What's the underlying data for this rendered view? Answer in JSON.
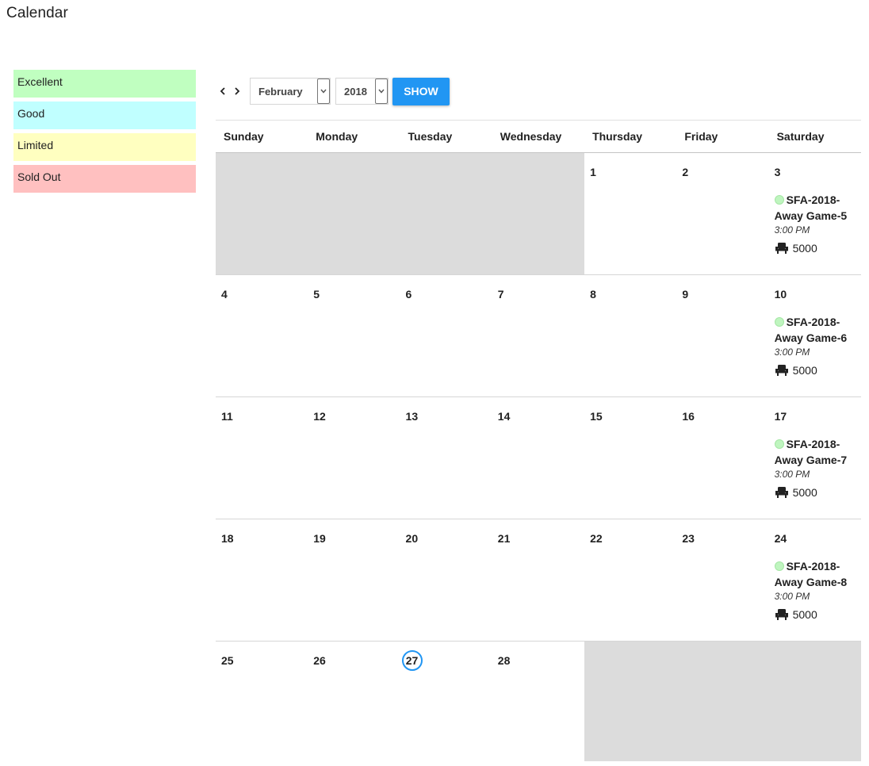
{
  "page": {
    "title": "Calendar"
  },
  "legend": [
    {
      "label": "Excellent",
      "color": "#c0ffc0"
    },
    {
      "label": "Good",
      "color": "#c0ffff"
    },
    {
      "label": "Limited",
      "color": "#ffffc0"
    },
    {
      "label": "Sold Out",
      "color": "#ffc0c0"
    }
  ],
  "toolbar": {
    "prev_icon": "chevron-left-icon",
    "next_icon": "chevron-right-icon",
    "month": "February",
    "year": "2018",
    "show_label": "SHOW"
  },
  "calendar": {
    "weekdays": [
      "Sunday",
      "Monday",
      "Tuesday",
      "Wednesday",
      "Thursday",
      "Friday",
      "Saturday"
    ],
    "today": "27",
    "accent_color": "#2196f3",
    "weeks": [
      [
        "",
        "",
        "",
        "",
        "1",
        "2",
        "3"
      ],
      [
        "4",
        "5",
        "6",
        "7",
        "8",
        "9",
        "10"
      ],
      [
        "11",
        "12",
        "13",
        "14",
        "15",
        "16",
        "17"
      ],
      [
        "18",
        "19",
        "20",
        "21",
        "22",
        "23",
        "24"
      ],
      [
        "25",
        "26",
        "27",
        "28",
        "",
        "",
        ""
      ]
    ],
    "events": [
      {
        "day": "3",
        "title": "SFA-2018-Away Game-5",
        "time": "3:00 PM",
        "seats": "5000",
        "status": "Excellent",
        "seat_icon": "seat-icon"
      },
      {
        "day": "10",
        "title": "SFA-2018-Away Game-6",
        "time": "3:00 PM",
        "seats": "5000",
        "status": "Excellent",
        "seat_icon": "seat-icon"
      },
      {
        "day": "17",
        "title": "SFA-2018-Away Game-7",
        "time": "3:00 PM",
        "seats": "5000",
        "status": "Excellent",
        "seat_icon": "seat-icon"
      },
      {
        "day": "24",
        "title": "SFA-2018-Away Game-8",
        "time": "3:00 PM",
        "seats": "5000",
        "status": "Excellent",
        "seat_icon": "seat-icon"
      }
    ]
  }
}
